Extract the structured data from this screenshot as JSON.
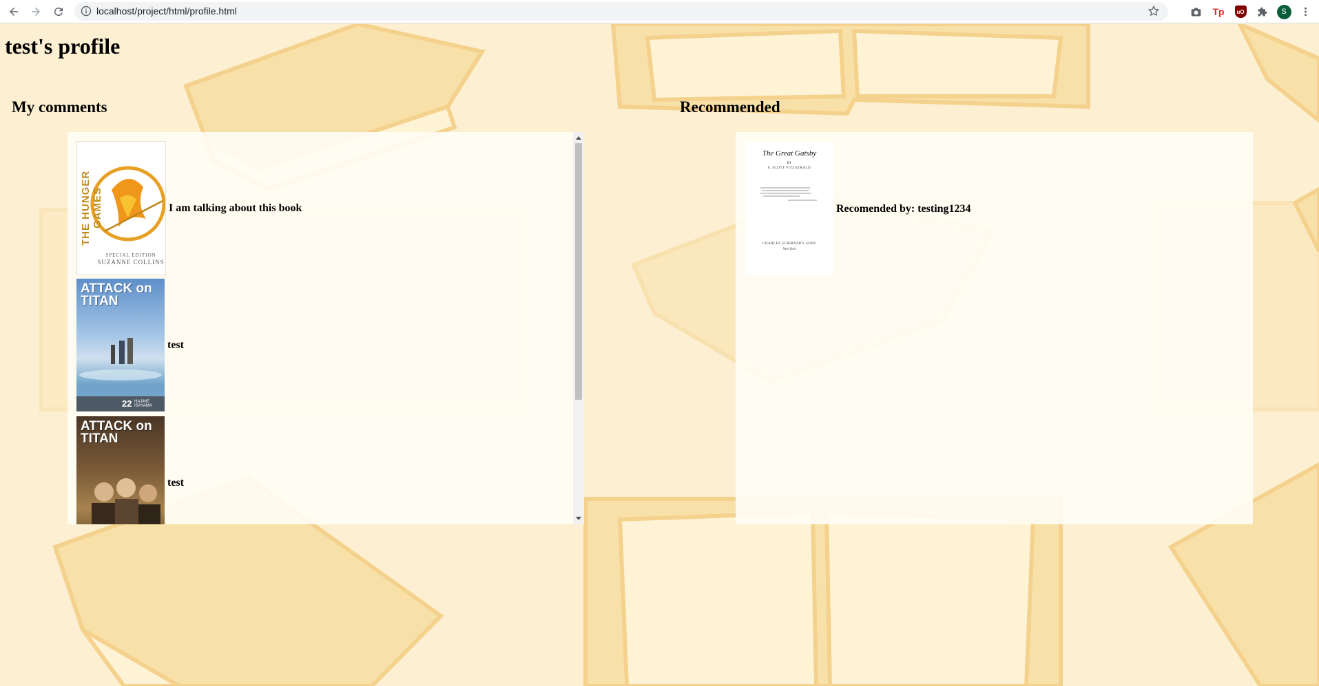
{
  "browser": {
    "url": "localhost/project/html/profile.html",
    "profile_initial": "S",
    "ext_tp_label": "Tp",
    "ext_ub_label": "uO"
  },
  "page": {
    "title": "test's profile",
    "comments_heading": "My comments",
    "recommended_heading": "Recommended"
  },
  "comments": [
    {
      "text": "I am talking about this book",
      "cover_title": "THE HUNGER GAMES",
      "cover_subtitle": "SPECIAL EDITION",
      "cover_author": "SUZANNE COLLINS"
    },
    {
      "text": "test",
      "cover_title": "ATTACK on TITAN",
      "cover_volume": "22",
      "cover_author": "HAJIME ISAYAMA"
    },
    {
      "text": "test",
      "cover_title": "ATTACK on TITAN"
    }
  ],
  "recommended": [
    {
      "text": "Recomended by: testing1234",
      "cover_title": "The Great Gatsby",
      "cover_by": "BY",
      "cover_author": "F. SCOTT FITZGERALD",
      "cover_publisher": "CHARLES SCRIBNER'S SONS",
      "cover_city": "New York"
    }
  ],
  "colors": {
    "background": "#fdf0d2",
    "panel": "#fffdf5",
    "accent_book": "#f6d58e",
    "profile_avatar": "#0b5d3c"
  }
}
